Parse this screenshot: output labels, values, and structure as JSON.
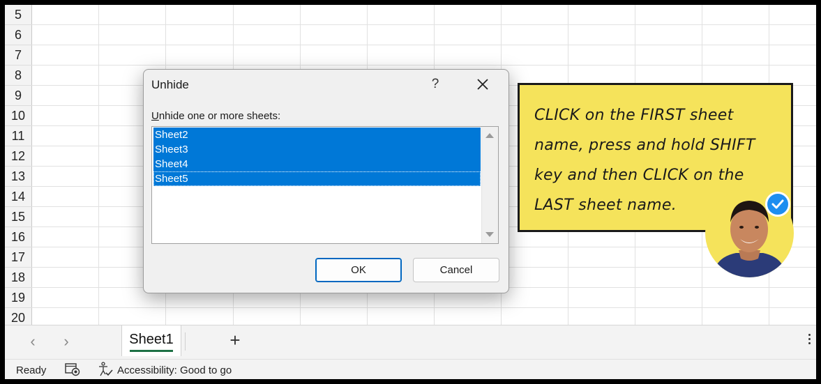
{
  "grid": {
    "rows": [
      "5",
      "6",
      "7",
      "8",
      "9",
      "10",
      "11",
      "12",
      "13",
      "14",
      "15",
      "16",
      "17",
      "18",
      "19",
      "20"
    ]
  },
  "sheet_tabs": {
    "prev_icon": "chevron-left-icon",
    "next_icon": "chevron-right-icon",
    "active_tab": "Sheet1",
    "add_label": "+",
    "accent_color": "#1e7145"
  },
  "status_bar": {
    "ready": "Ready",
    "accessibility": "Accessibility: Good to go"
  },
  "dialog": {
    "title": "Unhide",
    "help": "?",
    "prompt_accel": "U",
    "prompt_rest": "nhide one or more sheets:",
    "items": [
      "Sheet2",
      "Sheet3",
      "Sheet4",
      "Sheet5"
    ],
    "selection_color": "#0078d7",
    "ok_label": "OK",
    "cancel_label": "Cancel"
  },
  "note": {
    "text": "CLICK on the FIRST sheet name, press and hold SHIFT key and then CLICK on the LAST sheet name.",
    "background": "#f5e35b",
    "badge_icon": "check-badge-icon"
  }
}
